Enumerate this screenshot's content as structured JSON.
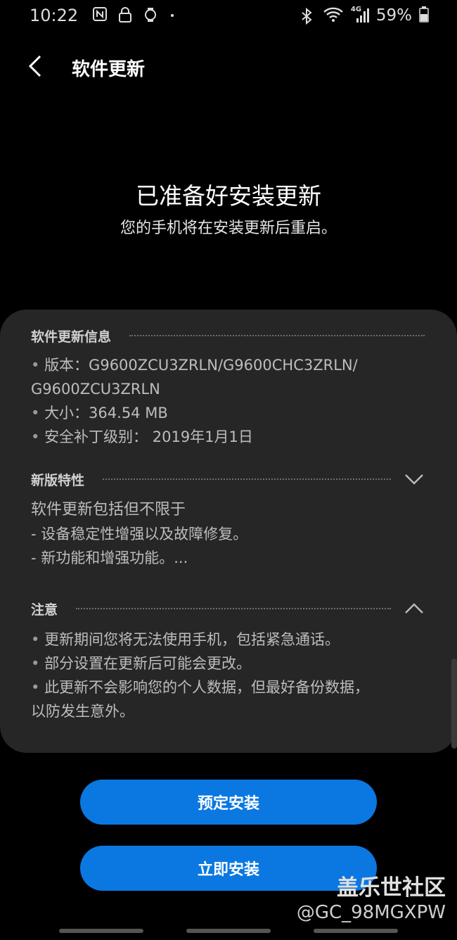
{
  "status_bar": {
    "time": "10:22",
    "battery": "59%",
    "icons_left": [
      "nfc-icon",
      "lock-icon",
      "watch-icon",
      "dot-icon"
    ],
    "icons_right": [
      "bluetooth-icon",
      "wifi-icon",
      "signal-4g-icon",
      "battery-icon"
    ],
    "network_label": "4G"
  },
  "header": {
    "title": "软件更新"
  },
  "hero": {
    "title": "已准备好安装更新",
    "subtitle": "您的手机将在安装更新后重启。"
  },
  "info_section": {
    "label": "软件更新信息",
    "lines": [
      "版本：G9600ZCU3ZRLN/G9600CHC3ZRLN/",
      "G9600ZCU3ZRLN",
      "大小：364.54 MB",
      "安全补丁级别： 2019年1月1日"
    ]
  },
  "features_section": {
    "label": "新版特性",
    "expanded": false,
    "lines": [
      "软件更新包括但不限于",
      "- 设备稳定性增强以及故障修复。",
      "- 新功能和增强功能。..."
    ]
  },
  "notice_section": {
    "label": "注意",
    "expanded": true,
    "lines": [
      "更新期间您将无法使用手机，包括紧急通话。",
      "部分设置在更新后可能会更改。",
      "此更新不会影响您的个人数据，但最好备份数据，",
      "以防发生意外。"
    ]
  },
  "buttons": {
    "schedule": "预定安装",
    "install_now": "立即安装"
  },
  "watermark": {
    "brand": "盖乐世社区",
    "user": "@GC_98MGXPW"
  },
  "colors": {
    "accent": "#0a78e0",
    "card_bg": "#262626",
    "background": "#000000"
  }
}
